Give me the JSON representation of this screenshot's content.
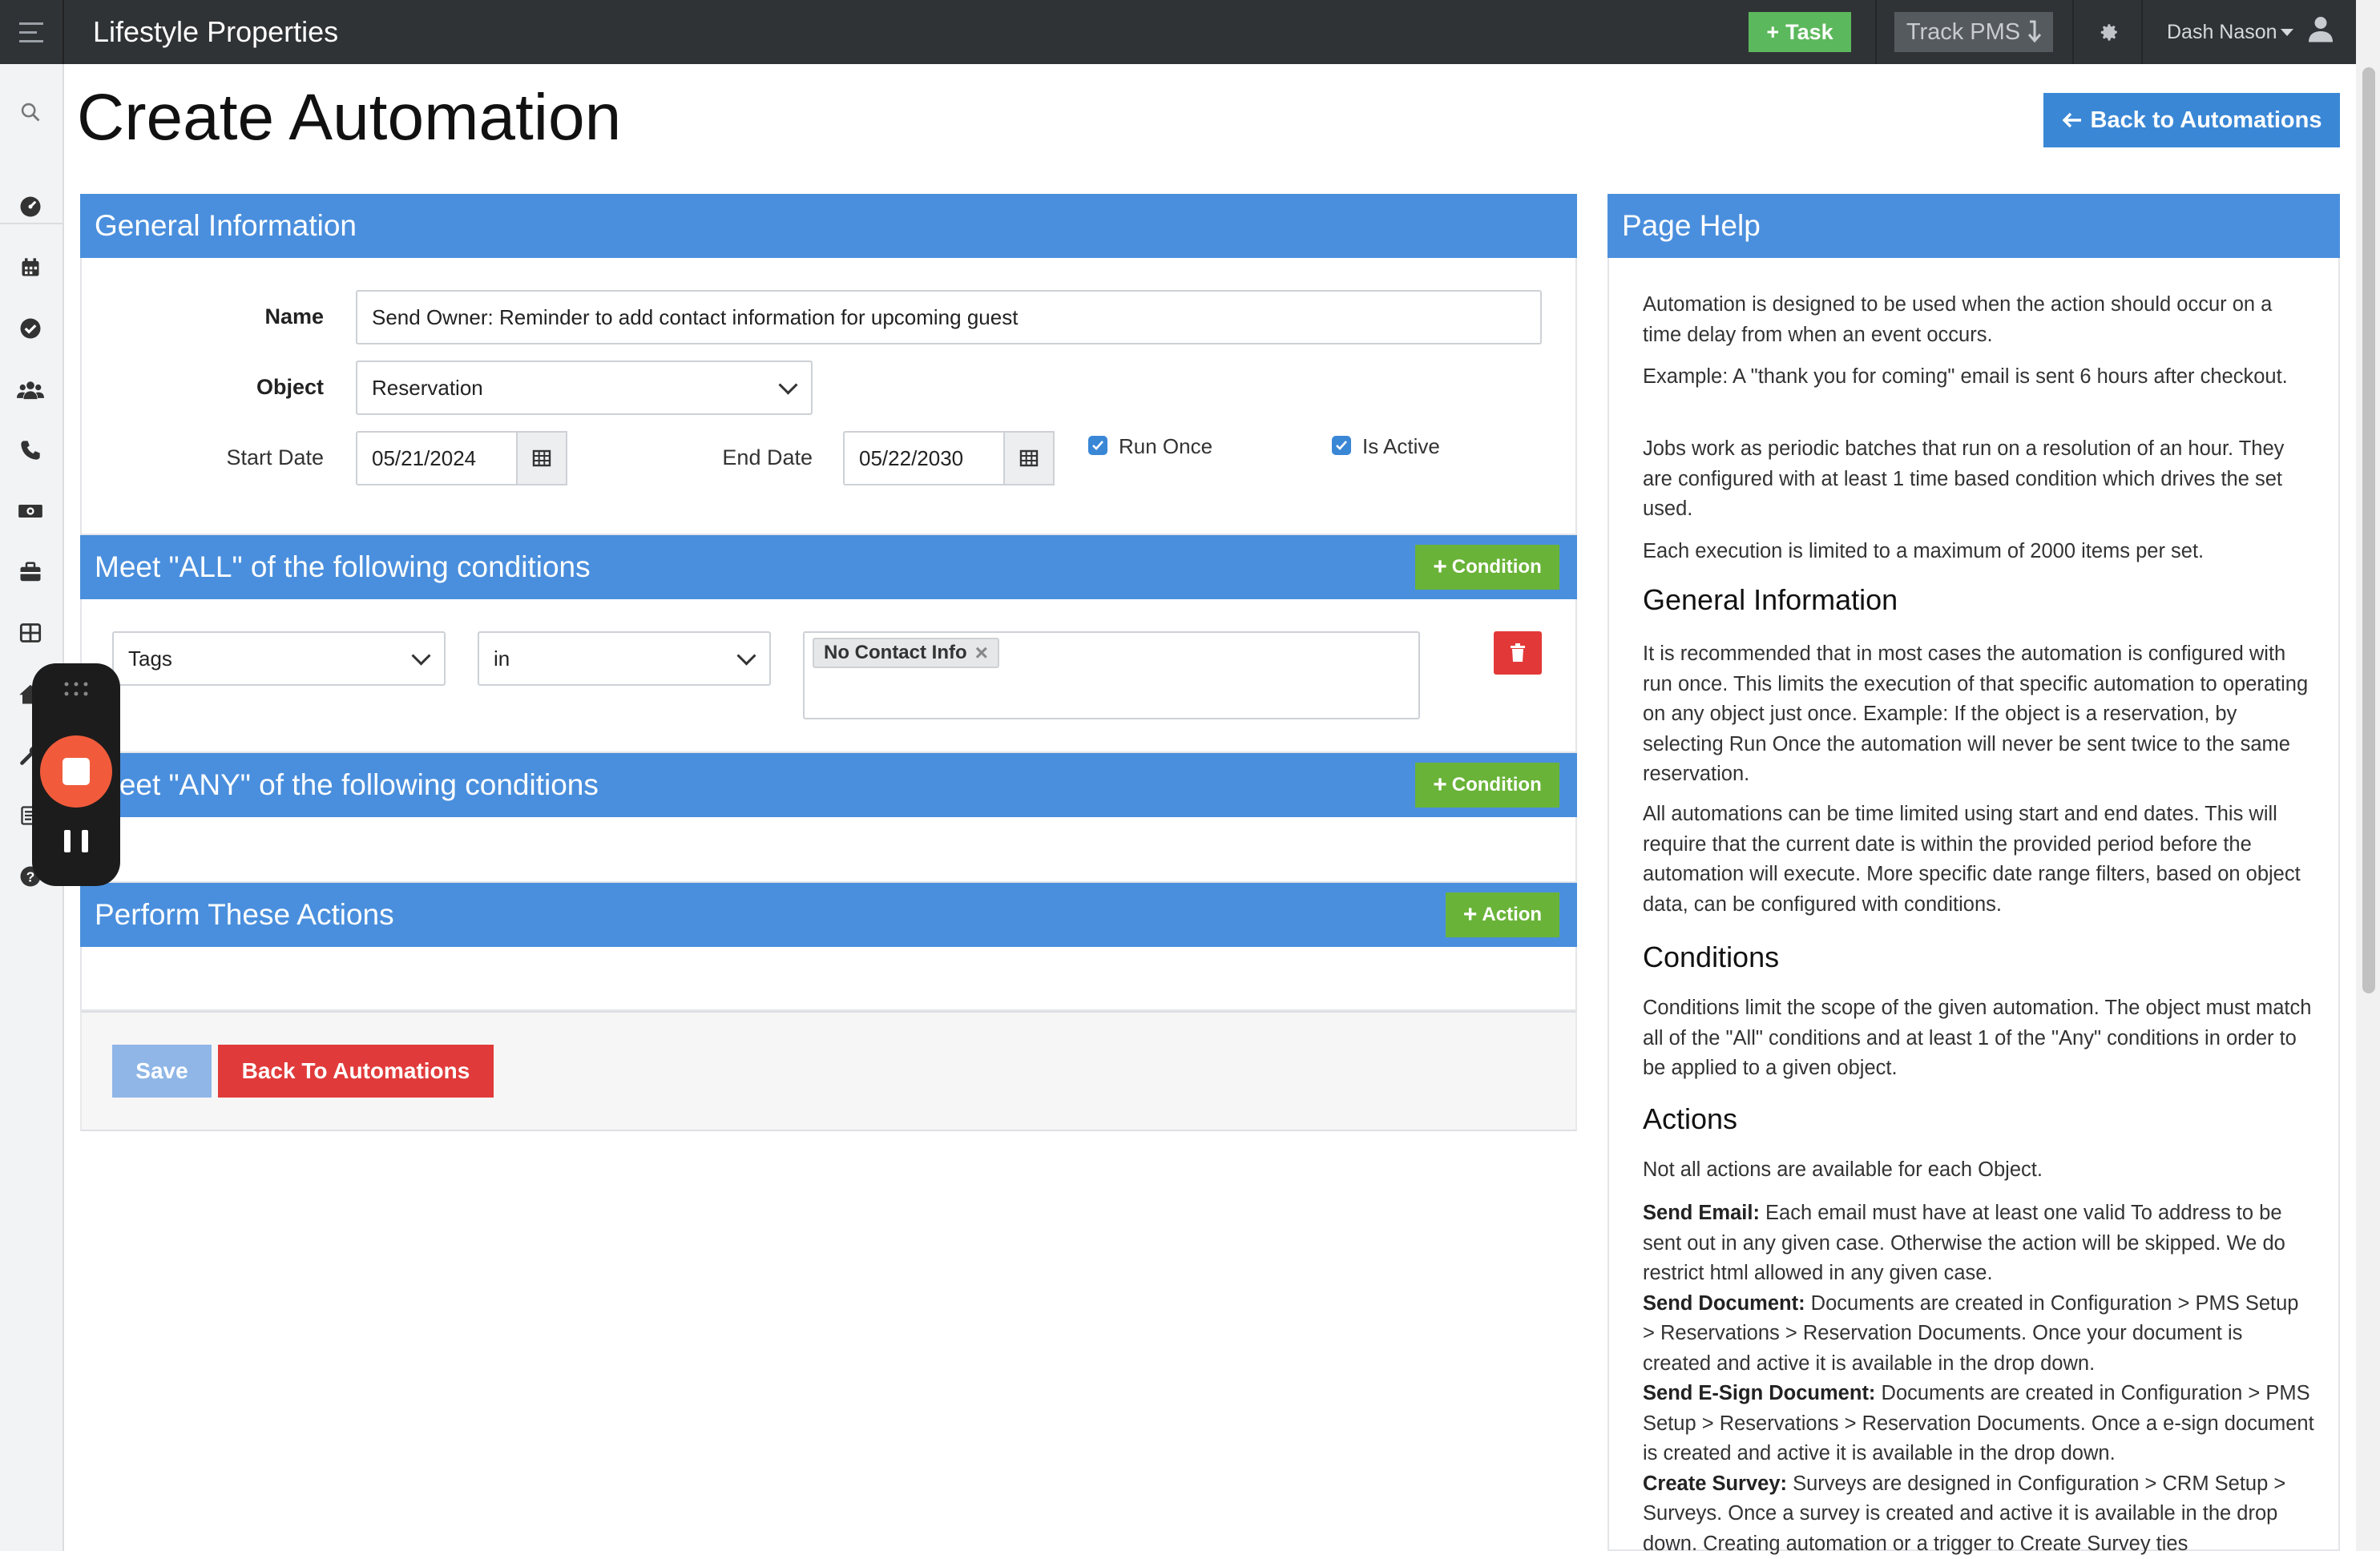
{
  "app": {
    "brand": "Lifestyle Properties",
    "task_button": "Task",
    "track_button": "Track PMS",
    "user_name": "Dash Nason"
  },
  "sidebar": {
    "items": [
      "search-icon",
      "dashboard-icon",
      "calendar-icon",
      "check-circle-icon",
      "users-icon",
      "phone-icon",
      "money-icon",
      "briefcase-icon",
      "grid-icon",
      "home-icon",
      "wrench-icon",
      "list-icon",
      "help-icon"
    ]
  },
  "page": {
    "title": "Create Automation",
    "back_button": "Back to Automations"
  },
  "general": {
    "header": "General Information",
    "name_label": "Name",
    "name_value": "Send Owner: Reminder to add contact information for upcoming guest",
    "object_label": "Object",
    "object_value": "Reservation",
    "start_label": "Start Date",
    "start_value": "05/21/2024",
    "end_label": "End Date",
    "end_value": "05/22/2030",
    "run_once_label": "Run Once",
    "run_once_checked": true,
    "is_active_label": "Is Active",
    "is_active_checked": true
  },
  "all_conditions": {
    "header": "Meet \"ALL\" of the following conditions",
    "add_button": "Condition",
    "row": {
      "field": "Tags",
      "operator": "in",
      "tag": "No Contact Info"
    }
  },
  "any_conditions": {
    "header": "Meet \"ANY\" of the following conditions",
    "add_button": "Condition"
  },
  "actions": {
    "header": "Perform These Actions",
    "add_button": "Action"
  },
  "footer": {
    "save": "Save",
    "back": "Back To Automations"
  },
  "help": {
    "header": "Page Help",
    "p1": "Automation is designed to be used when the action should occur on a time delay from when an event occurs.",
    "p2": "Example: A \"thank you for coming\" email is sent 6 hours after checkout.",
    "p3": "Jobs work as periodic batches that run on a resolution of an hour. They are configured with at least 1 time based condition which drives the set used.",
    "p4": "Each execution is limited to a maximum of 2000 items per set.",
    "h_general": "General Information",
    "p5": "It is recommended that in most cases the automation is configured with run once. This limits the execution of that specific automation to operating on any object just once. Example: If the object is a reservation, by selecting Run Once the automation will never be sent twice to the same reservation.",
    "p6": "All automations can be time limited using start and end dates. This will require that the current date is within the provided period before the automation will execute. More specific date range filters, based on object data, can be configured with conditions.",
    "h_conditions": "Conditions",
    "p7": "Conditions limit the scope of the given automation. The object must match all of the \"All\" conditions and at least 1 of the \"Any\" conditions in order to be applied to a given object.",
    "h_actions": "Actions",
    "p8": "Not all actions are available for each Object.",
    "send_email_t": "Send Email:",
    "send_email_d": " Each email must have at least one valid To address to be sent out in any given case. Otherwise the action will be skipped. We do restrict html allowed in any given case.",
    "send_doc_t": "Send Document:",
    "send_doc_d": " Documents are created in Configuration > PMS Setup > Reservations > Reservation Documents. Once your document is created and active it is available in the drop down.",
    "send_esign_t": "Send E-Sign Document:",
    "send_esign_d": " Documents are created in Configuration > PMS Setup > Reservations > Reservation Documents. Once a e-sign document is created and active it is available in the drop down.",
    "survey_t": "Create Survey:",
    "survey_d": " Surveys are designed in Configuration > CRM Setup > Surveys. Once a survey is created and active it is available in the drop down. Creating automation or a trigger to Create Survey ties"
  }
}
